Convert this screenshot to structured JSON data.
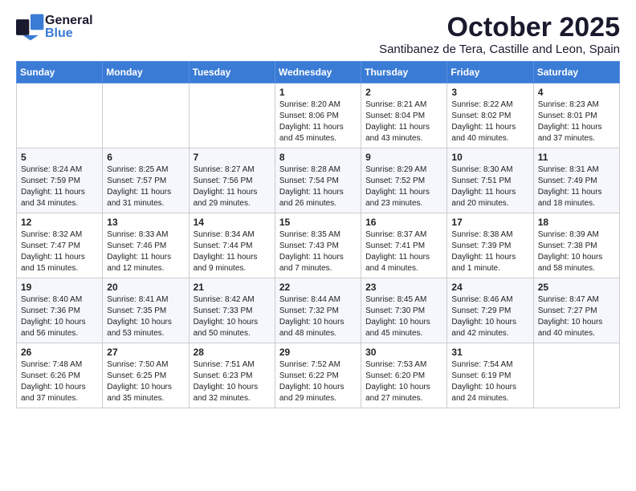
{
  "header": {
    "logo_general": "General",
    "logo_blue": "Blue",
    "month_title": "October 2025",
    "location": "Santibanez de Tera, Castille and Leon, Spain"
  },
  "weekdays": [
    "Sunday",
    "Monday",
    "Tuesday",
    "Wednesday",
    "Thursday",
    "Friday",
    "Saturday"
  ],
  "weeks": [
    [
      {
        "day": "",
        "sunrise": "",
        "sunset": "",
        "daylight": ""
      },
      {
        "day": "",
        "sunrise": "",
        "sunset": "",
        "daylight": ""
      },
      {
        "day": "",
        "sunrise": "",
        "sunset": "",
        "daylight": ""
      },
      {
        "day": "1",
        "sunrise": "Sunrise: 8:20 AM",
        "sunset": "Sunset: 8:06 PM",
        "daylight": "Daylight: 11 hours and 45 minutes."
      },
      {
        "day": "2",
        "sunrise": "Sunrise: 8:21 AM",
        "sunset": "Sunset: 8:04 PM",
        "daylight": "Daylight: 11 hours and 43 minutes."
      },
      {
        "day": "3",
        "sunrise": "Sunrise: 8:22 AM",
        "sunset": "Sunset: 8:02 PM",
        "daylight": "Daylight: 11 hours and 40 minutes."
      },
      {
        "day": "4",
        "sunrise": "Sunrise: 8:23 AM",
        "sunset": "Sunset: 8:01 PM",
        "daylight": "Daylight: 11 hours and 37 minutes."
      }
    ],
    [
      {
        "day": "5",
        "sunrise": "Sunrise: 8:24 AM",
        "sunset": "Sunset: 7:59 PM",
        "daylight": "Daylight: 11 hours and 34 minutes."
      },
      {
        "day": "6",
        "sunrise": "Sunrise: 8:25 AM",
        "sunset": "Sunset: 7:57 PM",
        "daylight": "Daylight: 11 hours and 31 minutes."
      },
      {
        "day": "7",
        "sunrise": "Sunrise: 8:27 AM",
        "sunset": "Sunset: 7:56 PM",
        "daylight": "Daylight: 11 hours and 29 minutes."
      },
      {
        "day": "8",
        "sunrise": "Sunrise: 8:28 AM",
        "sunset": "Sunset: 7:54 PM",
        "daylight": "Daylight: 11 hours and 26 minutes."
      },
      {
        "day": "9",
        "sunrise": "Sunrise: 8:29 AM",
        "sunset": "Sunset: 7:52 PM",
        "daylight": "Daylight: 11 hours and 23 minutes."
      },
      {
        "day": "10",
        "sunrise": "Sunrise: 8:30 AM",
        "sunset": "Sunset: 7:51 PM",
        "daylight": "Daylight: 11 hours and 20 minutes."
      },
      {
        "day": "11",
        "sunrise": "Sunrise: 8:31 AM",
        "sunset": "Sunset: 7:49 PM",
        "daylight": "Daylight: 11 hours and 18 minutes."
      }
    ],
    [
      {
        "day": "12",
        "sunrise": "Sunrise: 8:32 AM",
        "sunset": "Sunset: 7:47 PM",
        "daylight": "Daylight: 11 hours and 15 minutes."
      },
      {
        "day": "13",
        "sunrise": "Sunrise: 8:33 AM",
        "sunset": "Sunset: 7:46 PM",
        "daylight": "Daylight: 11 hours and 12 minutes."
      },
      {
        "day": "14",
        "sunrise": "Sunrise: 8:34 AM",
        "sunset": "Sunset: 7:44 PM",
        "daylight": "Daylight: 11 hours and 9 minutes."
      },
      {
        "day": "15",
        "sunrise": "Sunrise: 8:35 AM",
        "sunset": "Sunset: 7:43 PM",
        "daylight": "Daylight: 11 hours and 7 minutes."
      },
      {
        "day": "16",
        "sunrise": "Sunrise: 8:37 AM",
        "sunset": "Sunset: 7:41 PM",
        "daylight": "Daylight: 11 hours and 4 minutes."
      },
      {
        "day": "17",
        "sunrise": "Sunrise: 8:38 AM",
        "sunset": "Sunset: 7:39 PM",
        "daylight": "Daylight: 11 hours and 1 minute."
      },
      {
        "day": "18",
        "sunrise": "Sunrise: 8:39 AM",
        "sunset": "Sunset: 7:38 PM",
        "daylight": "Daylight: 10 hours and 58 minutes."
      }
    ],
    [
      {
        "day": "19",
        "sunrise": "Sunrise: 8:40 AM",
        "sunset": "Sunset: 7:36 PM",
        "daylight": "Daylight: 10 hours and 56 minutes."
      },
      {
        "day": "20",
        "sunrise": "Sunrise: 8:41 AM",
        "sunset": "Sunset: 7:35 PM",
        "daylight": "Daylight: 10 hours and 53 minutes."
      },
      {
        "day": "21",
        "sunrise": "Sunrise: 8:42 AM",
        "sunset": "Sunset: 7:33 PM",
        "daylight": "Daylight: 10 hours and 50 minutes."
      },
      {
        "day": "22",
        "sunrise": "Sunrise: 8:44 AM",
        "sunset": "Sunset: 7:32 PM",
        "daylight": "Daylight: 10 hours and 48 minutes."
      },
      {
        "day": "23",
        "sunrise": "Sunrise: 8:45 AM",
        "sunset": "Sunset: 7:30 PM",
        "daylight": "Daylight: 10 hours and 45 minutes."
      },
      {
        "day": "24",
        "sunrise": "Sunrise: 8:46 AM",
        "sunset": "Sunset: 7:29 PM",
        "daylight": "Daylight: 10 hours and 42 minutes."
      },
      {
        "day": "25",
        "sunrise": "Sunrise: 8:47 AM",
        "sunset": "Sunset: 7:27 PM",
        "daylight": "Daylight: 10 hours and 40 minutes."
      }
    ],
    [
      {
        "day": "26",
        "sunrise": "Sunrise: 7:48 AM",
        "sunset": "Sunset: 6:26 PM",
        "daylight": "Daylight: 10 hours and 37 minutes."
      },
      {
        "day": "27",
        "sunrise": "Sunrise: 7:50 AM",
        "sunset": "Sunset: 6:25 PM",
        "daylight": "Daylight: 10 hours and 35 minutes."
      },
      {
        "day": "28",
        "sunrise": "Sunrise: 7:51 AM",
        "sunset": "Sunset: 6:23 PM",
        "daylight": "Daylight: 10 hours and 32 minutes."
      },
      {
        "day": "29",
        "sunrise": "Sunrise: 7:52 AM",
        "sunset": "Sunset: 6:22 PM",
        "daylight": "Daylight: 10 hours and 29 minutes."
      },
      {
        "day": "30",
        "sunrise": "Sunrise: 7:53 AM",
        "sunset": "Sunset: 6:20 PM",
        "daylight": "Daylight: 10 hours and 27 minutes."
      },
      {
        "day": "31",
        "sunrise": "Sunrise: 7:54 AM",
        "sunset": "Sunset: 6:19 PM",
        "daylight": "Daylight: 10 hours and 24 minutes."
      },
      {
        "day": "",
        "sunrise": "",
        "sunset": "",
        "daylight": ""
      }
    ]
  ]
}
